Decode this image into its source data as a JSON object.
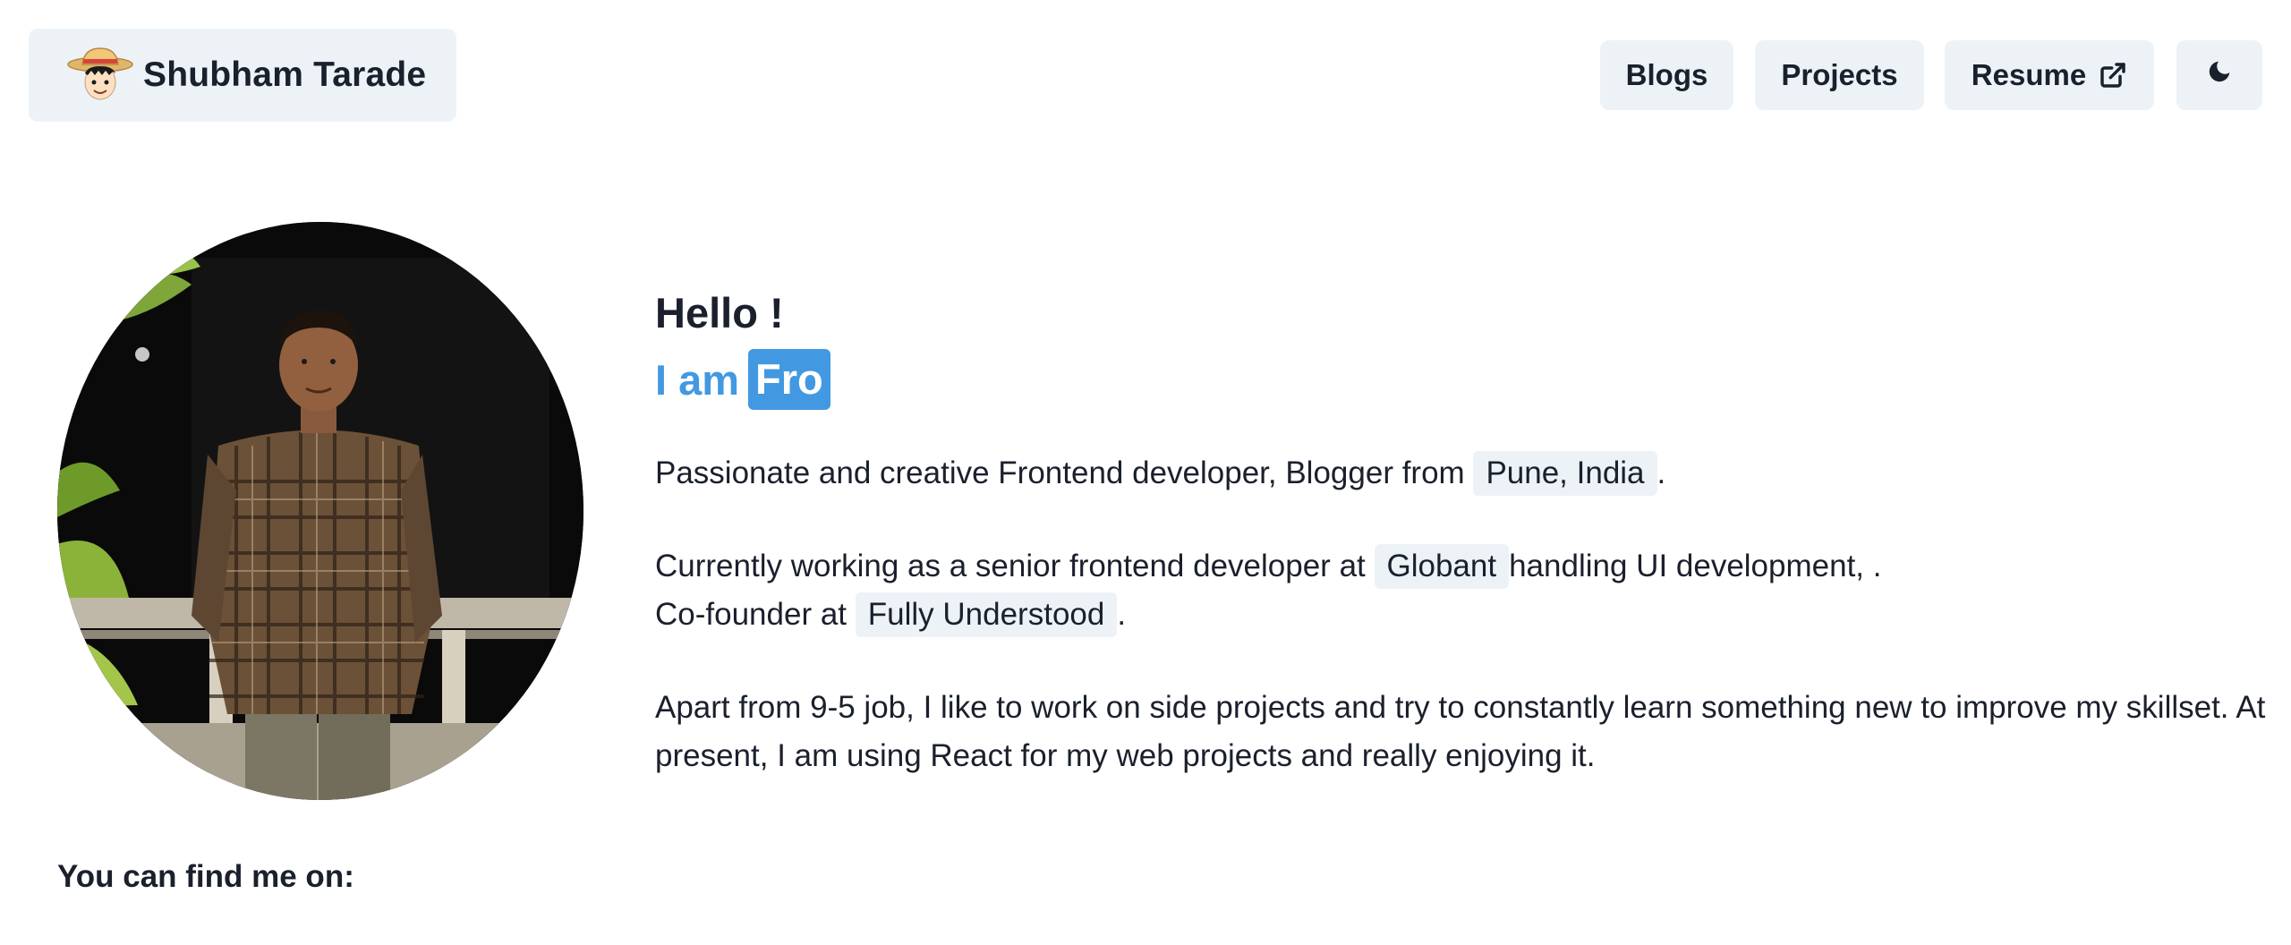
{
  "header": {
    "brand_name": "Shubham Tarade",
    "avatar_icon": "straw-hat-avatar-icon",
    "nav": {
      "blogs": "Blogs",
      "projects": "Projects",
      "resume": "Resume"
    },
    "resume_icon": "external-link-icon",
    "theme_icon": "moon-icon"
  },
  "intro": {
    "hello": "Hello !",
    "iam": "I am",
    "typed_role": "Fro",
    "p1_text": "Passionate and creative Frontend developer, Blogger from",
    "p1_chip": "Pune, India",
    "p1_end": ".",
    "p2_text": "Currently working as a senior frontend developer at",
    "p2_chip": "Globant",
    "p2_after": "handling UI development, .",
    "p2_line2": "Co-founder at",
    "p2_chip2": "Fully Understood",
    "p2_end": ".",
    "p3_text": "Apart from 9-5 job, I like to work on side projects and try to constantly learn something new to improve my skillset. At present, I am using React for my web projects and really enjoying it."
  },
  "social": {
    "heading": "You can find me on:"
  },
  "colors": {
    "accent": "#4299e1",
    "chip_bg": "#edf2f7",
    "text": "#1a202c"
  }
}
